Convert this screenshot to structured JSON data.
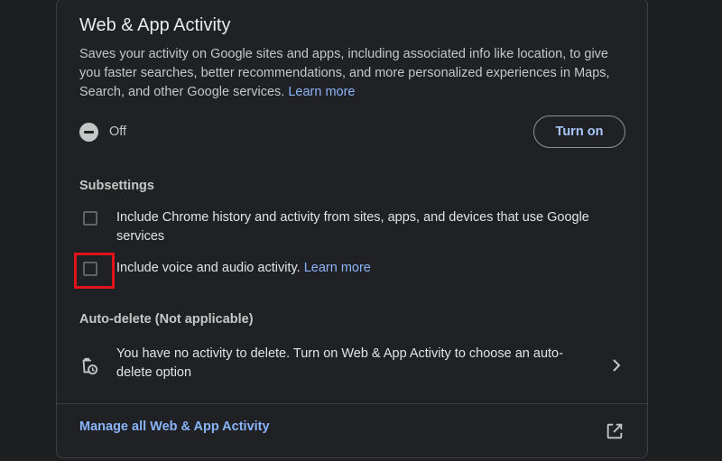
{
  "card": {
    "title": "Web & App Activity",
    "description": "Saves your activity on Google sites and apps, including associated info like location, to give you faster searches, better recommendations, and more personalized experiences in Maps, Search, and other Google services.",
    "learn_more": "Learn more"
  },
  "status": {
    "label": "Off",
    "icon": "off-circle-icon"
  },
  "turn_on_button": "Turn on",
  "subsettings": {
    "heading": "Subsettings",
    "items": [
      {
        "label": "Include Chrome history and activity from sites, apps, and devices that use Google services",
        "checked": false
      },
      {
        "label": "Include voice and audio activity.",
        "link": "Learn more",
        "checked": false
      }
    ]
  },
  "auto_delete": {
    "heading": "Auto-delete (Not applicable)",
    "text": "You have no activity to delete. Turn on Web & App Activity to choose an auto-delete option",
    "icon": "auto-delete-icon"
  },
  "footer": {
    "manage_link": "Manage all Web & App Activity",
    "icon": "open-in-new-icon"
  },
  "colors": {
    "background": "#202124",
    "accent": "#8ab4f8",
    "highlight": "#e0121a"
  }
}
